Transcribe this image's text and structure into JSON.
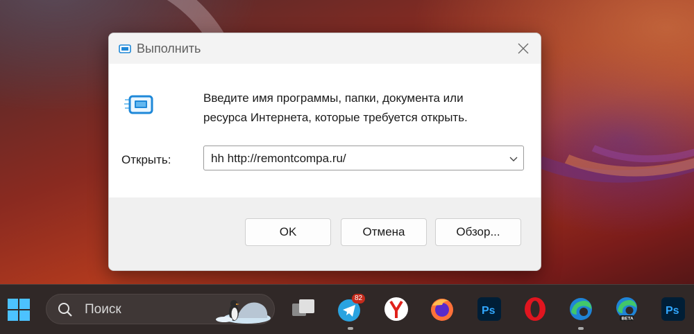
{
  "dialog": {
    "title": "Выполнить",
    "description_line1": "Введите имя программы, папки, документа или",
    "description_line2": "ресурса Интернета, которые требуется открыть.",
    "open_label": "Открыть:",
    "open_value": "hh http://remontcompa.ru/",
    "buttons": {
      "ok": "OK",
      "cancel": "Отмена",
      "browse": "Обзор..."
    }
  },
  "taskbar": {
    "search_placeholder": "Поиск",
    "telegram_badge": "82",
    "apps": [
      "task-view",
      "telegram",
      "yandex-browser",
      "firefox",
      "photoshop",
      "opera",
      "edge",
      "edge-beta",
      "photoshop-2"
    ]
  },
  "colors": {
    "dialog_bg": "#ffffff",
    "footer_bg": "#f0f0f0",
    "taskbar_bg": "#302827",
    "accent_blue": "#1e88d8"
  }
}
